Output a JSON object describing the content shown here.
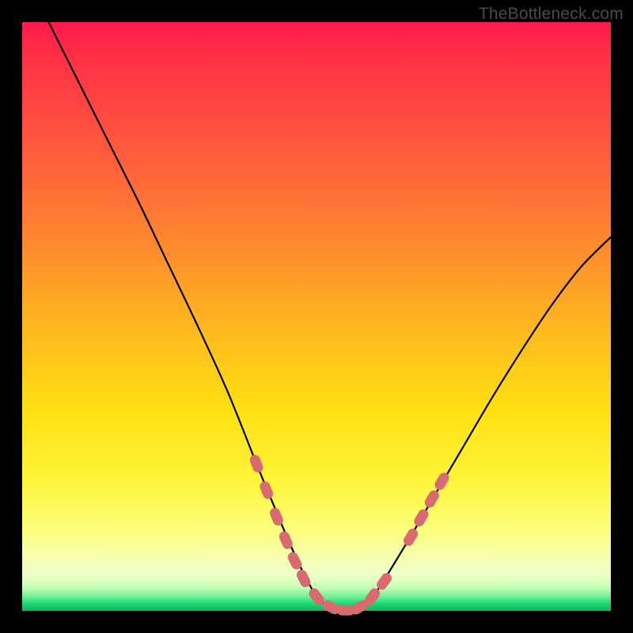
{
  "watermark": "TheBottleneck.com",
  "chart_data": {
    "type": "line",
    "title": "",
    "xlabel": "",
    "ylabel": "",
    "xlim": [
      0,
      1
    ],
    "ylim": [
      0,
      1
    ],
    "series": [
      {
        "name": "curve",
        "x": [
          0.045,
          0.1,
          0.15,
          0.2,
          0.25,
          0.3,
          0.35,
          0.4,
          0.425,
          0.45,
          0.475,
          0.5,
          0.525,
          0.55,
          0.575,
          0.6,
          0.65,
          0.7,
          0.75,
          0.8,
          0.85,
          0.9,
          0.95,
          1.0
        ],
        "y": [
          1.0,
          0.89,
          0.79,
          0.69,
          0.585,
          0.48,
          0.37,
          0.245,
          0.185,
          0.125,
          0.07,
          0.025,
          0.005,
          0.0,
          0.005,
          0.03,
          0.11,
          0.195,
          0.28,
          0.365,
          0.445,
          0.52,
          0.585,
          0.635
        ]
      }
    ],
    "markers": {
      "name": "beads",
      "color": "#d96a70",
      "points": [
        {
          "x": 0.398,
          "y": 0.25
        },
        {
          "x": 0.415,
          "y": 0.205
        },
        {
          "x": 0.432,
          "y": 0.16
        },
        {
          "x": 0.448,
          "y": 0.12
        },
        {
          "x": 0.463,
          "y": 0.085
        },
        {
          "x": 0.478,
          "y": 0.055
        },
        {
          "x": 0.5,
          "y": 0.024
        },
        {
          "x": 0.525,
          "y": 0.006
        },
        {
          "x": 0.55,
          "y": 0.001
        },
        {
          "x": 0.573,
          "y": 0.006
        },
        {
          "x": 0.595,
          "y": 0.024
        },
        {
          "x": 0.615,
          "y": 0.05
        },
        {
          "x": 0.66,
          "y": 0.125
        },
        {
          "x": 0.678,
          "y": 0.158
        },
        {
          "x": 0.696,
          "y": 0.19
        },
        {
          "x": 0.713,
          "y": 0.22
        }
      ]
    }
  }
}
